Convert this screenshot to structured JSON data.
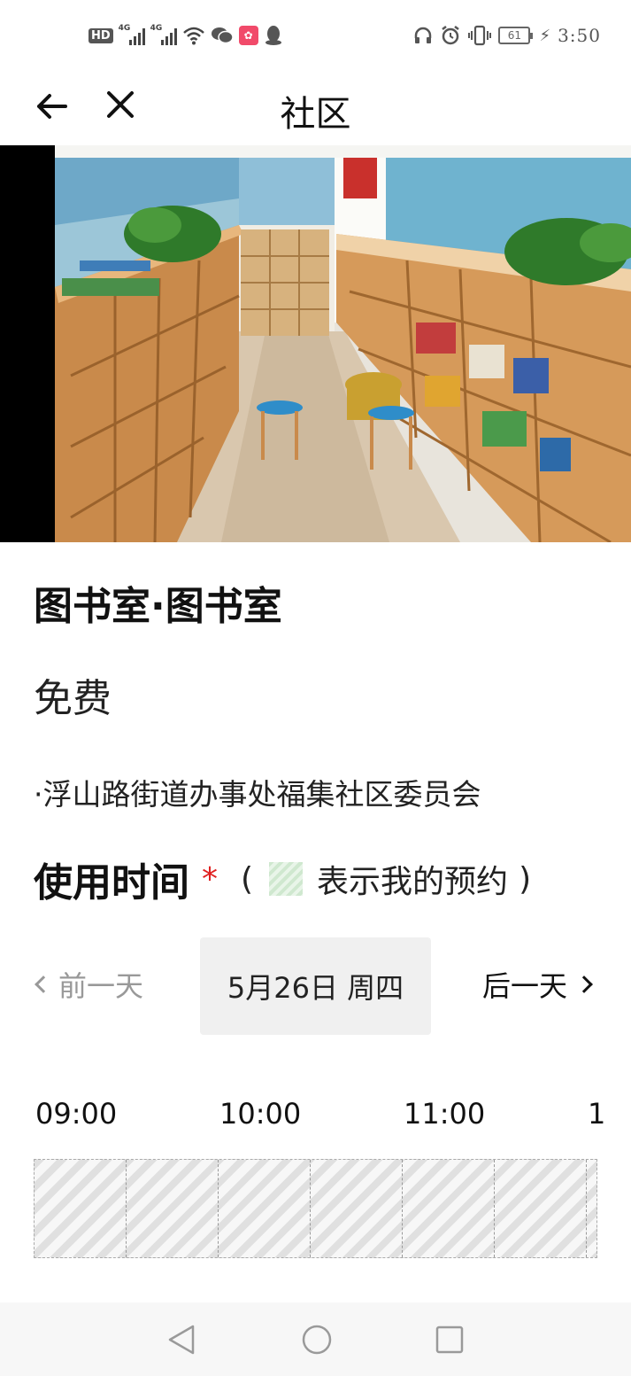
{
  "status_bar": {
    "time": "3:50",
    "battery": "61",
    "network_type_1": "4G",
    "network_type_2": "4G",
    "hd_label": "HD",
    "icons": [
      "hd-icon",
      "signal-icon",
      "signal-icon",
      "wifi-icon",
      "wechat-icon",
      "app-icon",
      "qq-icon",
      "headphones-icon",
      "alarm-icon",
      "vibrate-icon",
      "battery-icon",
      "charging-icon"
    ]
  },
  "header": {
    "title": "社区",
    "back_icon": "arrow-left-icon",
    "close_icon": "close-icon"
  },
  "facility": {
    "name": "图书室·图书室",
    "price": "免费",
    "address": "·浮山路街道办事处福集社区委员会"
  },
  "usage": {
    "label": "使用时间",
    "required_mark": "*",
    "legend_open": "(",
    "legend_text": "表示我的预约",
    "legend_close": ")",
    "legend_color": "#d6ecd6"
  },
  "day_nav": {
    "prev_label": "前一天",
    "current_date": "5月26日 周四",
    "next_label": "后一天"
  },
  "timeline": {
    "hours": [
      "09:00",
      "10:00",
      "11:00",
      "1"
    ]
  },
  "nav_bar": {
    "icons": [
      "triangle-back-icon",
      "circle-home-icon",
      "square-recent-icon"
    ]
  }
}
